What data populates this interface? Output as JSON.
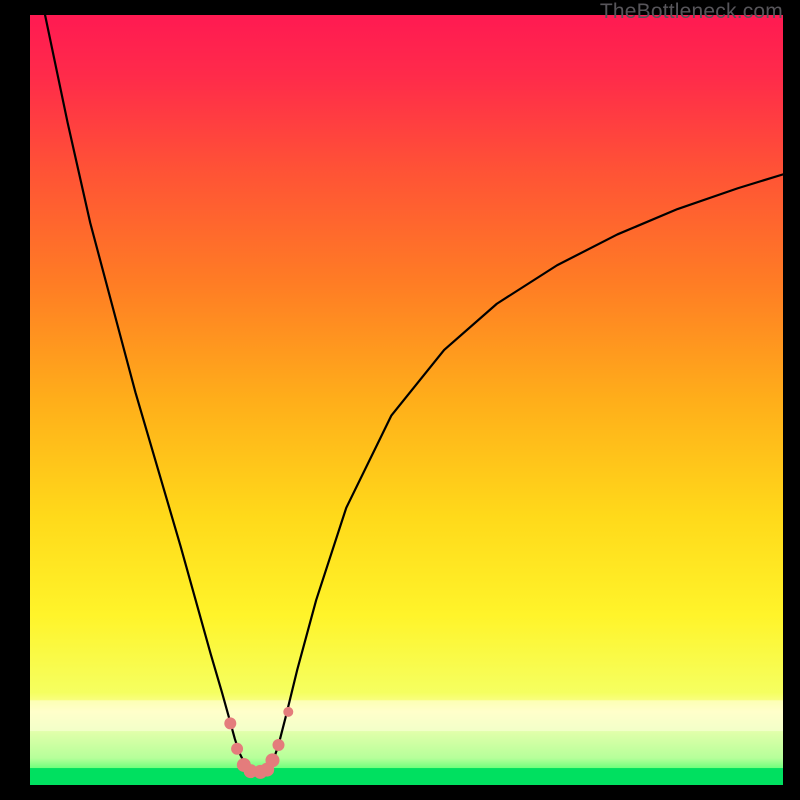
{
  "watermark": "TheBottleneck.com",
  "colors": {
    "black": "#000000",
    "curve": "#000000",
    "marker_fill": "#e47c7c",
    "marker_stroke": "#c86a6a"
  },
  "chart_data": {
    "type": "line",
    "title": "",
    "xlabel": "",
    "ylabel": "",
    "xlim": [
      0,
      100
    ],
    "ylim": [
      0,
      100
    ],
    "grid": false,
    "curve": {
      "x": [
        2,
        5,
        8,
        11,
        14,
        17,
        20,
        22,
        24,
        25.5,
        26.5,
        27.2,
        27.8,
        28.5,
        29.5,
        30.5,
        31.5,
        32.3,
        33,
        34,
        35.5,
        38,
        42,
        48,
        55,
        62,
        70,
        78,
        86,
        94,
        100
      ],
      "y": [
        100,
        86,
        73,
        62,
        51,
        41,
        31,
        24,
        17,
        12,
        8.5,
        6,
        4.2,
        2.8,
        1.8,
        1.6,
        2.0,
        3.2,
        5.2,
        9,
        15,
        24,
        36,
        48,
        56.5,
        62.5,
        67.5,
        71.5,
        74.8,
        77.5,
        79.3
      ]
    },
    "green_band": {
      "y_top": 2.2,
      "y_bottom": 0
    },
    "yellow_band": {
      "y_top": 11,
      "y_bottom": 7
    },
    "markers": [
      {
        "x": 26.6,
        "y": 8.0,
        "r": 6
      },
      {
        "x": 27.5,
        "y": 4.7,
        "r": 6
      },
      {
        "x": 28.4,
        "y": 2.6,
        "r": 7
      },
      {
        "x": 29.3,
        "y": 1.8,
        "r": 7
      },
      {
        "x": 30.6,
        "y": 1.7,
        "r": 7
      },
      {
        "x": 31.5,
        "y": 2.0,
        "r": 7
      },
      {
        "x": 32.2,
        "y": 3.2,
        "r": 7
      },
      {
        "x": 33.0,
        "y": 5.2,
        "r": 6
      },
      {
        "x": 34.3,
        "y": 9.5,
        "r": 5
      }
    ]
  }
}
